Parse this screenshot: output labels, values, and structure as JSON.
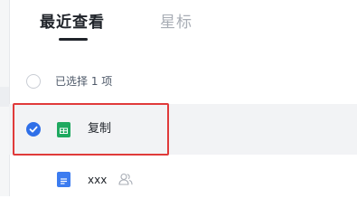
{
  "tabs": {
    "recent_label": "最近查看",
    "starred_label": "星标"
  },
  "selection": {
    "count_text": "已选择 1 项"
  },
  "files": [
    {
      "name": "复制",
      "type": "sheet",
      "selected": true
    },
    {
      "name": "xxx",
      "type": "doc",
      "selected": false,
      "shared": true
    }
  ],
  "colors": {
    "accent": "#2f6fe8",
    "sheet": "#1fa960",
    "doc": "#3c7cf0",
    "highlight": "#e03a3a"
  },
  "icons": {
    "check": "check-icon",
    "sheet": "spreadsheet-file-icon",
    "doc": "document-file-icon",
    "shared": "shared-user-icon"
  }
}
